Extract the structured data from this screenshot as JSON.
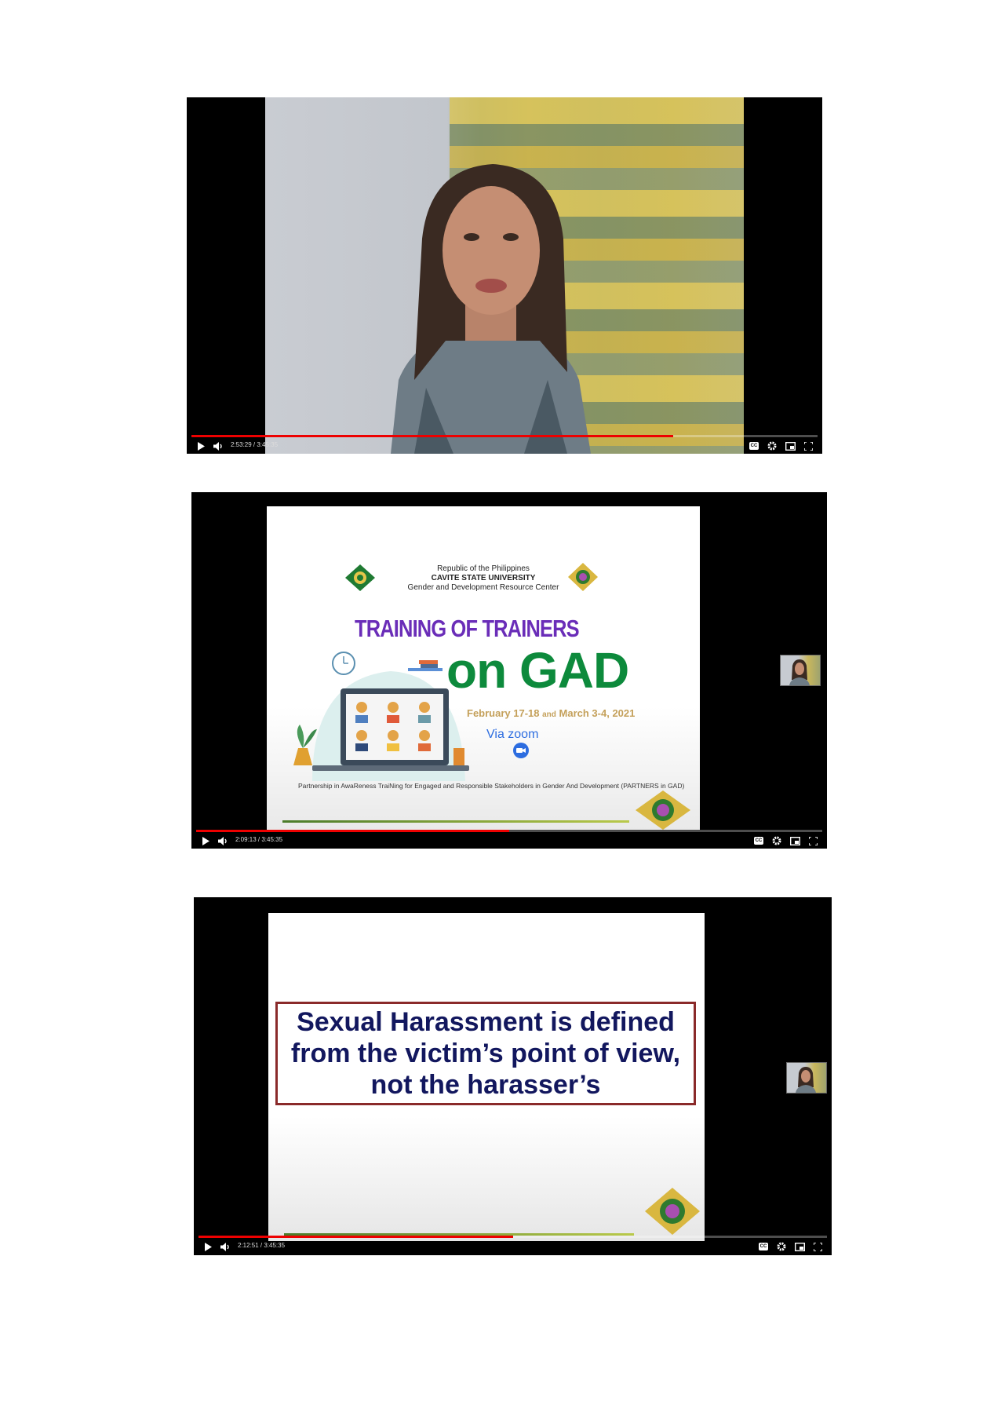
{
  "players": [
    {
      "time": "2:53:29 / 3:45:35",
      "progress": 0.77
    },
    {
      "time": "2:09:13 / 3:45:35",
      "progress": 0.5
    },
    {
      "time": "2:12:51 / 3:45:35",
      "progress": 0.5
    }
  ],
  "slide2": {
    "header_line1": "Republic of the Philippines",
    "header_line2": "CAVITE STATE UNIVERSITY",
    "header_line3": "Gender and Development Resource Center",
    "title_line1": "TRAINING OF TRAINERS",
    "title_line2": "on GAD",
    "dates_a": "February 17-18",
    "dates_and": "and",
    "dates_b": "March 3-4, 2021",
    "via_text": "Via zoom",
    "partnership": "Partnership in AwaReness TraiNing for Engaged and Responsible Stakeholders in Gender And Development (PARTNERS in GAD)"
  },
  "slide3": {
    "definition": "Sexual Harassment is defined from the victim’s point of view, not the harasser’s"
  },
  "icons": {
    "play": "play-icon",
    "volume": "volume-icon",
    "cc": "CC",
    "settings": "gear-icon",
    "miniplayer": "miniplayer-icon",
    "fullscreen": "fullscreen-icon"
  },
  "colors": {
    "progress": "#e00000",
    "title_purple": "#6a2db8",
    "title_green": "#0d8a3c",
    "definition_text": "#12175e",
    "definition_border": "#8a2a2a"
  }
}
